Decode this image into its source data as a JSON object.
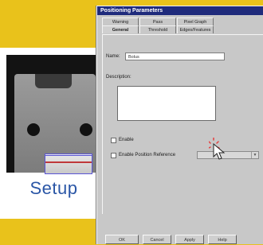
{
  "setup": {
    "label": "Setup"
  },
  "dialog": {
    "title": "Positioning Parameters",
    "tabs_back": [
      "Warning",
      "Pass",
      "Pixel Graph"
    ],
    "tabs_front": [
      "General",
      "Threshold",
      "Edges/Features"
    ],
    "name_label": "Name:",
    "name_value": "Bolus",
    "description_label": "Description:",
    "checkbox1_label": "Enable",
    "checkbox2_label": "Enable Position Reference",
    "buttons": [
      "OK",
      "Cancel",
      "Apply",
      "Help"
    ]
  }
}
